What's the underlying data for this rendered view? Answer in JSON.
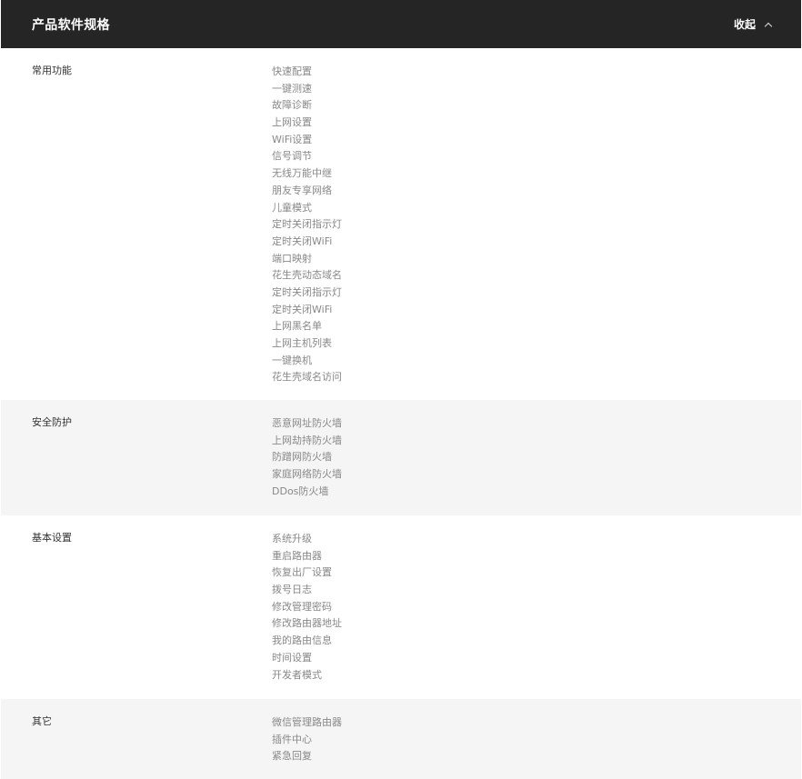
{
  "header": {
    "title": "产品软件规格",
    "collapse_label": "收起"
  },
  "sections": [
    {
      "label": "常用功能",
      "items": [
        "快速配置",
        "一键测速",
        "故障诊断",
        "上网设置",
        "WiFi设置",
        "信号调节",
        "无线万能中继",
        "朋友专享网络",
        "儿童模式",
        "定时关闭指示灯",
        "定时关闭WiFi",
        "端口映射",
        "花生壳动态域名",
        "定时关闭指示灯",
        "定时关闭WiFi",
        "上网黑名单",
        "上网主机列表",
        "一键换机",
        "花生壳域名访问"
      ]
    },
    {
      "label": "安全防护",
      "items": [
        "恶意网址防火墙",
        "上网劫持防火墙",
        "防蹭网防火墙",
        "家庭网络防火墙",
        "DDos防火墙"
      ]
    },
    {
      "label": "基本设置",
      "items": [
        "系统升级",
        "重启路由器",
        "恢复出厂设置",
        "拨号日志",
        "修改管理密码",
        "修改路由器地址",
        "我的路由信息",
        "时间设置",
        "开发者模式"
      ]
    },
    {
      "label": "其它",
      "items": [
        "微信管理路由器",
        "插件中心",
        "紧急回复"
      ]
    }
  ]
}
